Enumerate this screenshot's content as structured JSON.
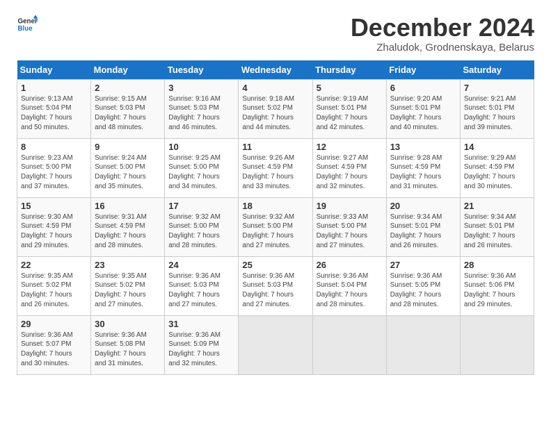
{
  "logo": {
    "line1": "General",
    "line2": "Blue"
  },
  "title": "December 2024",
  "subtitle": "Zhaludok, Grodnenskaya, Belarus",
  "weekdays": [
    "Sunday",
    "Monday",
    "Tuesday",
    "Wednesday",
    "Thursday",
    "Friday",
    "Saturday"
  ],
  "weeks": [
    [
      {
        "day": "1",
        "info": "Sunrise: 9:13 AM\nSunset: 5:04 PM\nDaylight: 7 hours\nand 50 minutes."
      },
      {
        "day": "2",
        "info": "Sunrise: 9:15 AM\nSunset: 5:03 PM\nDaylight: 7 hours\nand 48 minutes."
      },
      {
        "day": "3",
        "info": "Sunrise: 9:16 AM\nSunset: 5:03 PM\nDaylight: 7 hours\nand 46 minutes."
      },
      {
        "day": "4",
        "info": "Sunrise: 9:18 AM\nSunset: 5:02 PM\nDaylight: 7 hours\nand 44 minutes."
      },
      {
        "day": "5",
        "info": "Sunrise: 9:19 AM\nSunset: 5:01 PM\nDaylight: 7 hours\nand 42 minutes."
      },
      {
        "day": "6",
        "info": "Sunrise: 9:20 AM\nSunset: 5:01 PM\nDaylight: 7 hours\nand 40 minutes."
      },
      {
        "day": "7",
        "info": "Sunrise: 9:21 AM\nSunset: 5:01 PM\nDaylight: 7 hours\nand 39 minutes."
      }
    ],
    [
      {
        "day": "8",
        "info": "Sunrise: 9:23 AM\nSunset: 5:00 PM\nDaylight: 7 hours\nand 37 minutes."
      },
      {
        "day": "9",
        "info": "Sunrise: 9:24 AM\nSunset: 5:00 PM\nDaylight: 7 hours\nand 35 minutes."
      },
      {
        "day": "10",
        "info": "Sunrise: 9:25 AM\nSunset: 5:00 PM\nDaylight: 7 hours\nand 34 minutes."
      },
      {
        "day": "11",
        "info": "Sunrise: 9:26 AM\nSunset: 4:59 PM\nDaylight: 7 hours\nand 33 minutes."
      },
      {
        "day": "12",
        "info": "Sunrise: 9:27 AM\nSunset: 4:59 PM\nDaylight: 7 hours\nand 32 minutes."
      },
      {
        "day": "13",
        "info": "Sunrise: 9:28 AM\nSunset: 4:59 PM\nDaylight: 7 hours\nand 31 minutes."
      },
      {
        "day": "14",
        "info": "Sunrise: 9:29 AM\nSunset: 4:59 PM\nDaylight: 7 hours\nand 30 minutes."
      }
    ],
    [
      {
        "day": "15",
        "info": "Sunrise: 9:30 AM\nSunset: 4:59 PM\nDaylight: 7 hours\nand 29 minutes."
      },
      {
        "day": "16",
        "info": "Sunrise: 9:31 AM\nSunset: 4:59 PM\nDaylight: 7 hours\nand 28 minutes."
      },
      {
        "day": "17",
        "info": "Sunrise: 9:32 AM\nSunset: 5:00 PM\nDaylight: 7 hours\nand 28 minutes."
      },
      {
        "day": "18",
        "info": "Sunrise: 9:32 AM\nSunset: 5:00 PM\nDaylight: 7 hours\nand 27 minutes."
      },
      {
        "day": "19",
        "info": "Sunrise: 9:33 AM\nSunset: 5:00 PM\nDaylight: 7 hours\nand 27 minutes."
      },
      {
        "day": "20",
        "info": "Sunrise: 9:34 AM\nSunset: 5:01 PM\nDaylight: 7 hours\nand 26 minutes."
      },
      {
        "day": "21",
        "info": "Sunrise: 9:34 AM\nSunset: 5:01 PM\nDaylight: 7 hours\nand 26 minutes."
      }
    ],
    [
      {
        "day": "22",
        "info": "Sunrise: 9:35 AM\nSunset: 5:02 PM\nDaylight: 7 hours\nand 26 minutes."
      },
      {
        "day": "23",
        "info": "Sunrise: 9:35 AM\nSunset: 5:02 PM\nDaylight: 7 hours\nand 27 minutes."
      },
      {
        "day": "24",
        "info": "Sunrise: 9:36 AM\nSunset: 5:03 PM\nDaylight: 7 hours\nand 27 minutes."
      },
      {
        "day": "25",
        "info": "Sunrise: 9:36 AM\nSunset: 5:03 PM\nDaylight: 7 hours\nand 27 minutes."
      },
      {
        "day": "26",
        "info": "Sunrise: 9:36 AM\nSunset: 5:04 PM\nDaylight: 7 hours\nand 28 minutes."
      },
      {
        "day": "27",
        "info": "Sunrise: 9:36 AM\nSunset: 5:05 PM\nDaylight: 7 hours\nand 28 minutes."
      },
      {
        "day": "28",
        "info": "Sunrise: 9:36 AM\nSunset: 5:06 PM\nDaylight: 7 hours\nand 29 minutes."
      }
    ],
    [
      {
        "day": "29",
        "info": "Sunrise: 9:36 AM\nSunset: 5:07 PM\nDaylight: 7 hours\nand 30 minutes."
      },
      {
        "day": "30",
        "info": "Sunrise: 9:36 AM\nSunset: 5:08 PM\nDaylight: 7 hours\nand 31 minutes."
      },
      {
        "day": "31",
        "info": "Sunrise: 9:36 AM\nSunset: 5:09 PM\nDaylight: 7 hours\nand 32 minutes."
      },
      {
        "day": "",
        "info": ""
      },
      {
        "day": "",
        "info": ""
      },
      {
        "day": "",
        "info": ""
      },
      {
        "day": "",
        "info": ""
      }
    ]
  ]
}
